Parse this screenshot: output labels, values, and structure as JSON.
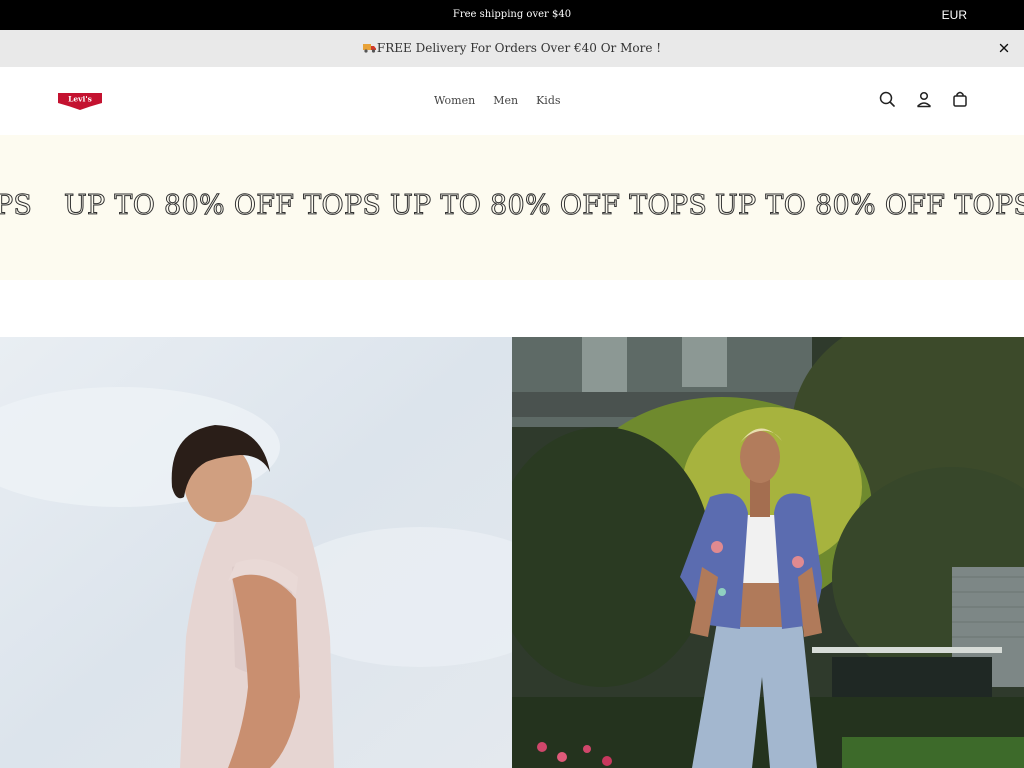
{
  "top_bar": {
    "message": "Free shipping over $40",
    "currency": "EUR"
  },
  "announcement": {
    "text": "FREE Delivery For Orders Over €40 Or More !",
    "icon": "truck-icon",
    "close_icon": "close-icon"
  },
  "header": {
    "logo_text": "Levi's",
    "nav": [
      "Women",
      "Men",
      "Kids"
    ],
    "icons": [
      "search-icon",
      "account-icon",
      "cart-icon"
    ]
  },
  "promo": {
    "marquee_text": "UP TO 80% OFF TOPS"
  },
  "colors": {
    "top_bar_bg": "#000000",
    "announcement_bg": "#e9e9e9",
    "promo_bg": "#fdfbf0",
    "logo_red": "#c41230"
  }
}
